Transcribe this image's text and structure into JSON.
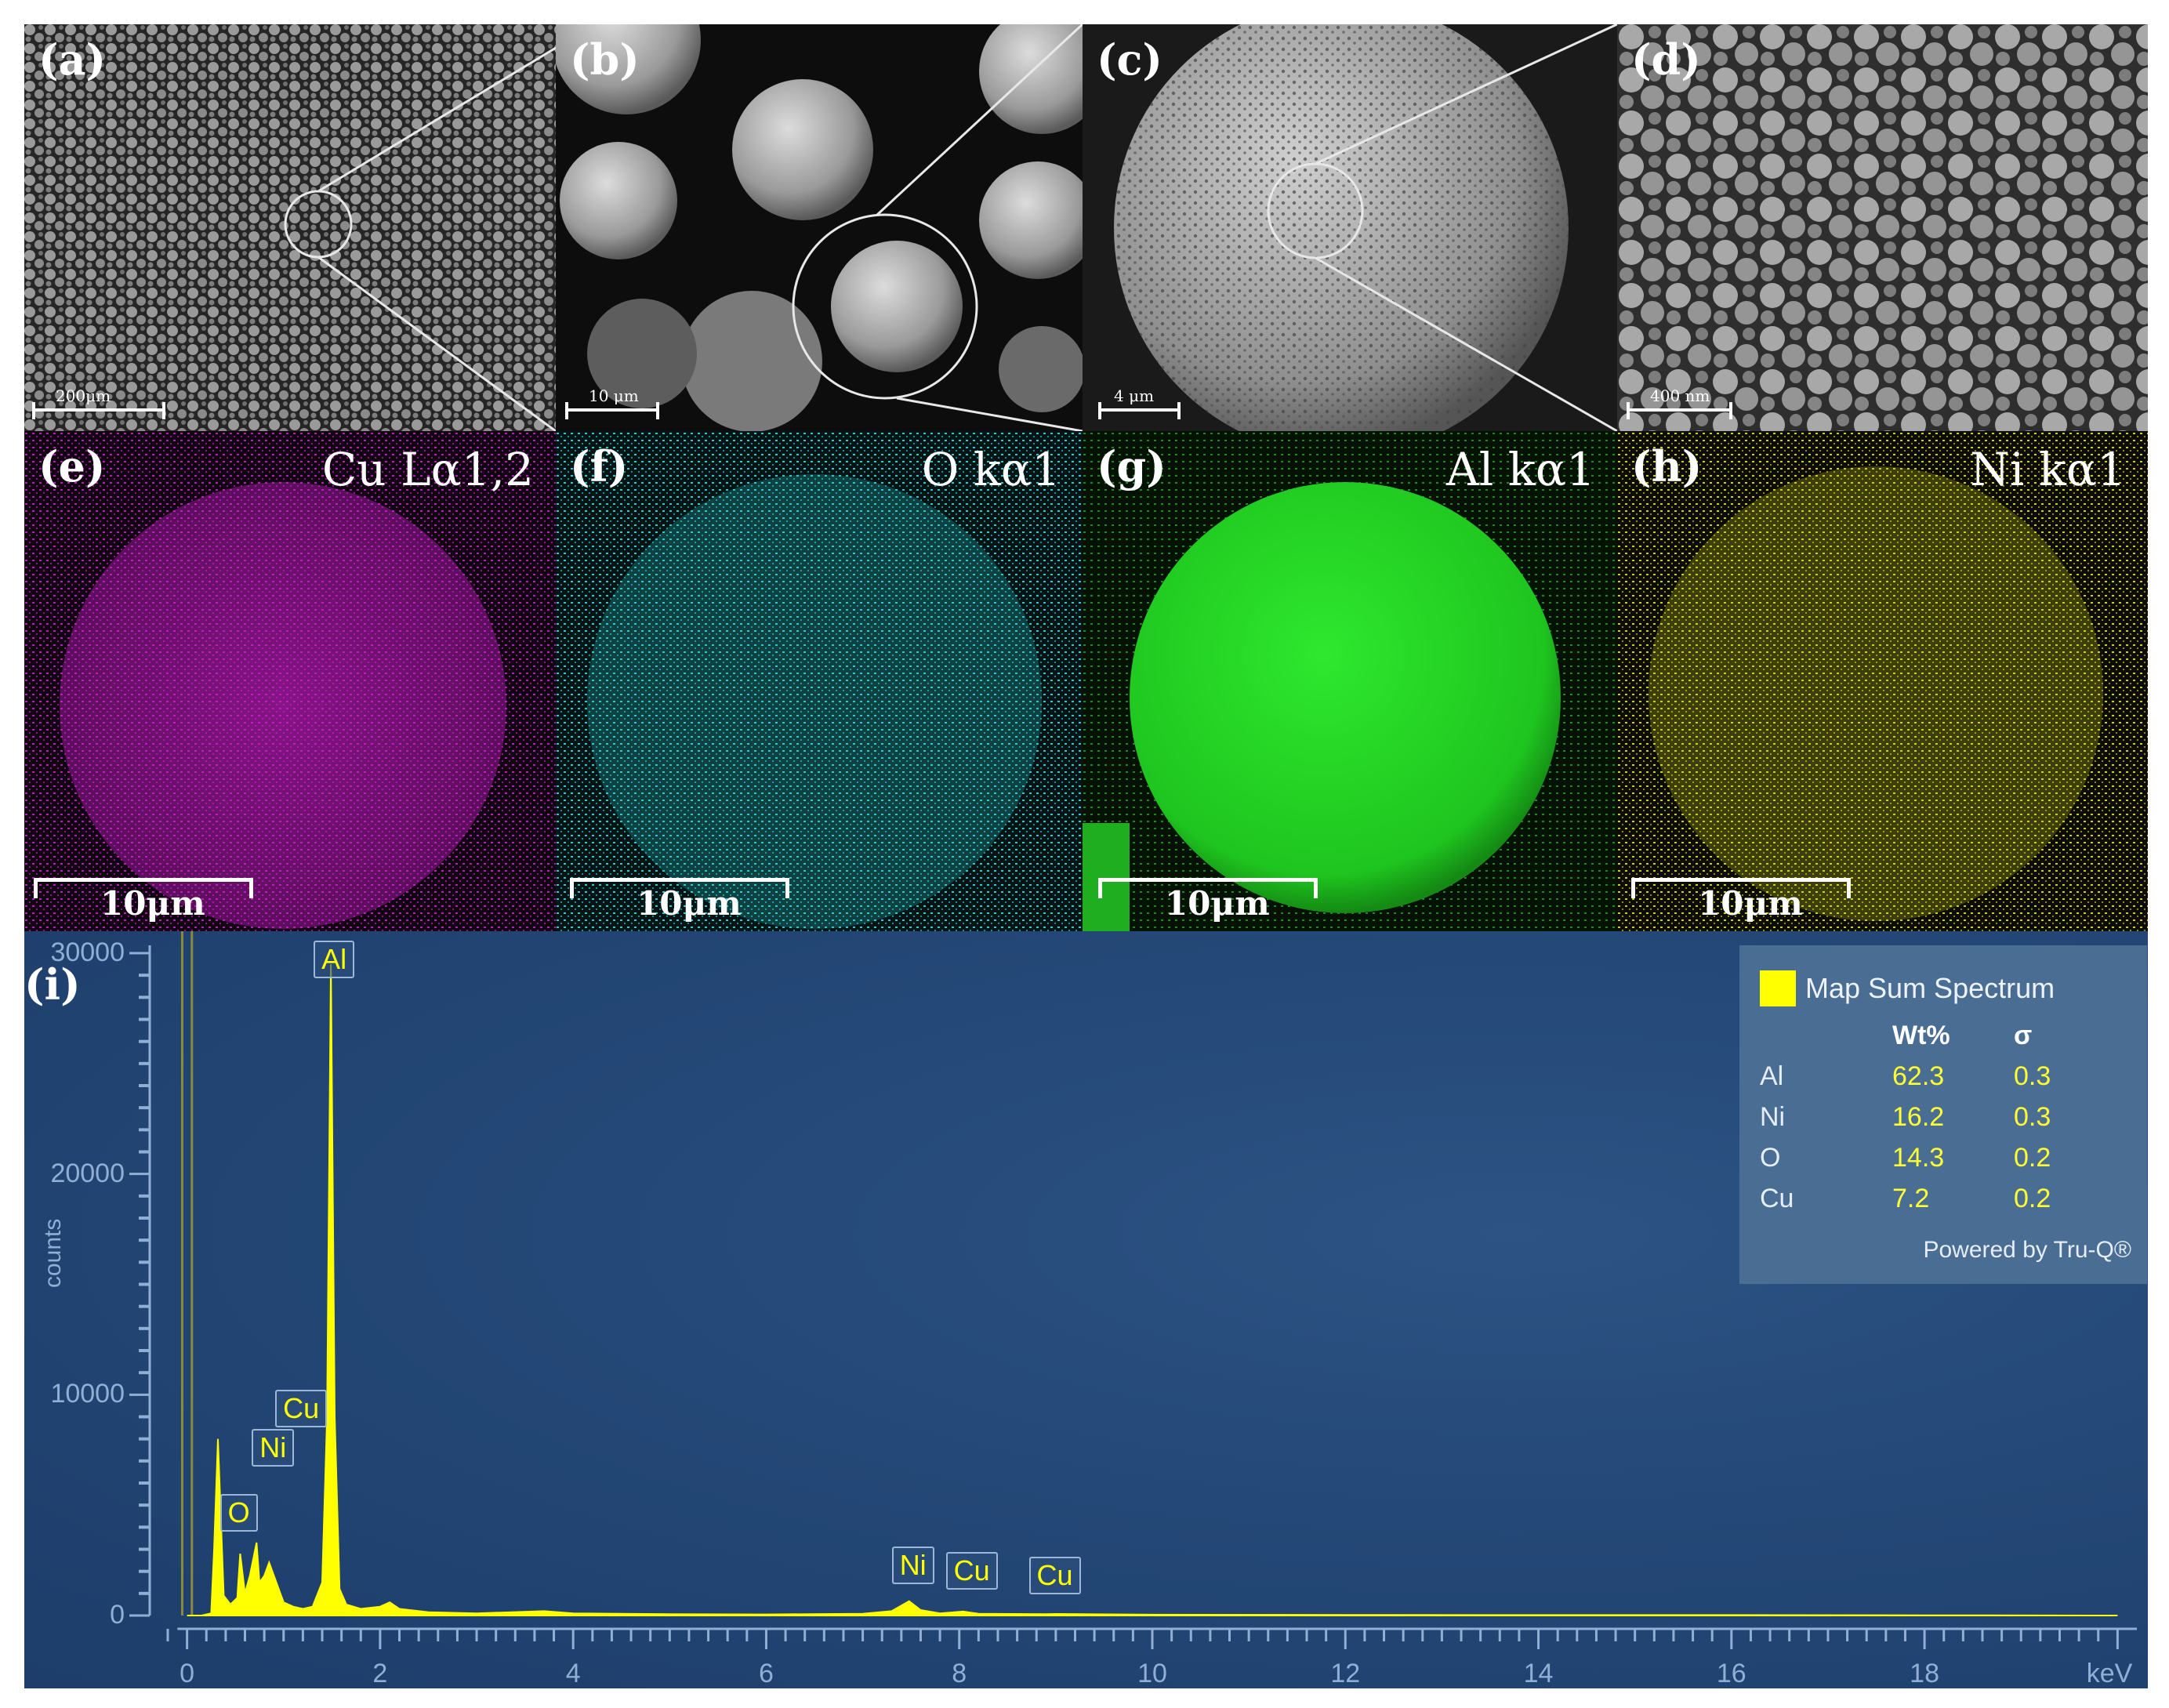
{
  "sem_panels": [
    {
      "id": "a",
      "label": "(a)",
      "scale": "200μm"
    },
    {
      "id": "b",
      "label": "(b)",
      "scale": "10 μm"
    },
    {
      "id": "c",
      "label": "(c)",
      "scale": "4 μm"
    },
    {
      "id": "d",
      "label": "(d)",
      "scale": "400 nm"
    }
  ],
  "map_panels": [
    {
      "id": "e",
      "label": "(e)",
      "element": "Cu Lα1,2",
      "scale": "10μm",
      "color": "#c81ec8"
    },
    {
      "id": "f",
      "label": "(f)",
      "element": "O kα1",
      "scale": "10μm",
      "color": "#2ec8d0"
    },
    {
      "id": "g",
      "label": "(g)",
      "element": "Al kα1",
      "scale": "10μm",
      "color": "#22d422"
    },
    {
      "id": "h",
      "label": "(h)",
      "element": "Ni kα1",
      "scale": "10μm",
      "color": "#d2d21a"
    }
  ],
  "spectrum_label": "(i)",
  "chart_data": {
    "type": "line",
    "xlabel": "keV",
    "ylabel": "counts",
    "xlim": [
      -0.2,
      20.2
    ],
    "ylim": [
      0,
      30000
    ],
    "x_ticks": [
      "0",
      "2",
      "4",
      "6",
      "8",
      "10",
      "12",
      "14",
      "16",
      "18",
      "keV"
    ],
    "y_ticks": [
      "30000",
      "20000",
      "10000",
      "0"
    ],
    "series": [
      {
        "name": "Map Sum Spectrum",
        "x": [
          0.0,
          0.15,
          0.25,
          0.28,
          0.32,
          0.38,
          0.45,
          0.52,
          0.55,
          0.6,
          0.65,
          0.72,
          0.75,
          0.8,
          0.85,
          0.9,
          0.95,
          1.0,
          1.1,
          1.2,
          1.3,
          1.4,
          1.45,
          1.49,
          1.53,
          1.58,
          1.65,
          1.8,
          2.0,
          2.1,
          2.2,
          2.5,
          3.0,
          3.7,
          4.0,
          5.0,
          6.0,
          7.0,
          7.3,
          7.48,
          7.6,
          7.8,
          8.04,
          8.2,
          8.9,
          9.0,
          10.0,
          12.0,
          14.0,
          16.0,
          18.0,
          20.0
        ],
        "y": [
          0,
          0,
          100,
          3000,
          8000,
          900,
          500,
          800,
          2800,
          1000,
          1800,
          3300,
          1500,
          1800,
          2400,
          1800,
          1200,
          600,
          400,
          300,
          400,
          1500,
          9000,
          29500,
          9000,
          1200,
          500,
          300,
          400,
          600,
          300,
          150,
          100,
          200,
          100,
          60,
          50,
          80,
          200,
          650,
          250,
          100,
          180,
          80,
          60,
          70,
          40,
          30,
          20,
          20,
          10,
          0
        ]
      }
    ],
    "peak_labels": [
      {
        "text": "Al",
        "x": 1.49
      },
      {
        "text": "Cu",
        "x": 0.93
      },
      {
        "text": "Ni",
        "x": 0.85
      },
      {
        "text": "O",
        "x": 0.52
      },
      {
        "text": "Ni",
        "x": 7.48
      },
      {
        "text": "Cu",
        "x": 8.04
      },
      {
        "text": "Cu",
        "x": 8.9
      }
    ],
    "legend": {
      "title": "Map Sum Spectrum",
      "col_wt": "Wt%",
      "col_sigma": "σ",
      "rows": [
        {
          "el": "Al",
          "wt": "62.3",
          "sigma": "0.3"
        },
        {
          "el": "Ni",
          "wt": "16.2",
          "sigma": "0.3"
        },
        {
          "el": "O",
          "wt": "14.3",
          "sigma": "0.2"
        },
        {
          "el": "Cu",
          "wt": "7.2",
          "sigma": "0.2"
        }
      ],
      "footer": "Powered by Tru-Q®"
    }
  }
}
